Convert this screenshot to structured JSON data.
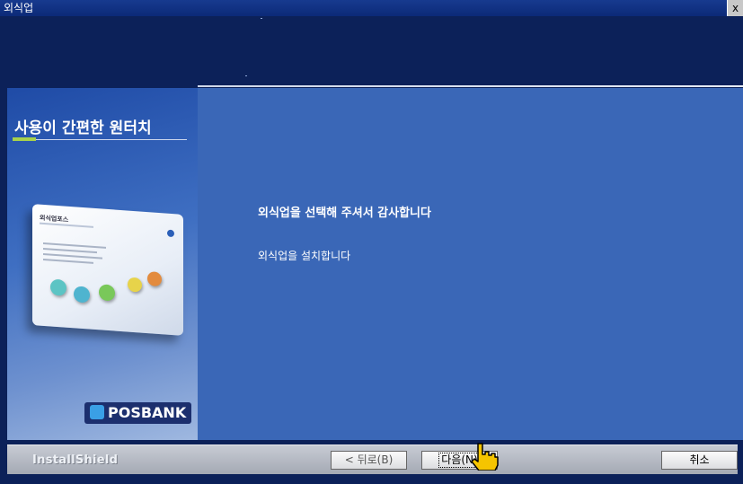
{
  "window": {
    "title": "외식업",
    "close_label": "x"
  },
  "side": {
    "tagline": "사용이 간편한 원터치",
    "card_title": "외식업포스",
    "brand": "POSBANK"
  },
  "main": {
    "heading": "외식업을 선택해 주셔서 감사합니다",
    "body": "외식업을 설치합니다"
  },
  "footer": {
    "installshield": "InstallShield",
    "back_label": "< 뒤로(B)",
    "next_label": "다음(N)",
    "cancel_label": "취소"
  },
  "colors": {
    "accent_green": "#a8d14b",
    "panel_blue": "#3a67b7",
    "pointer_red": "#d11a1a"
  }
}
